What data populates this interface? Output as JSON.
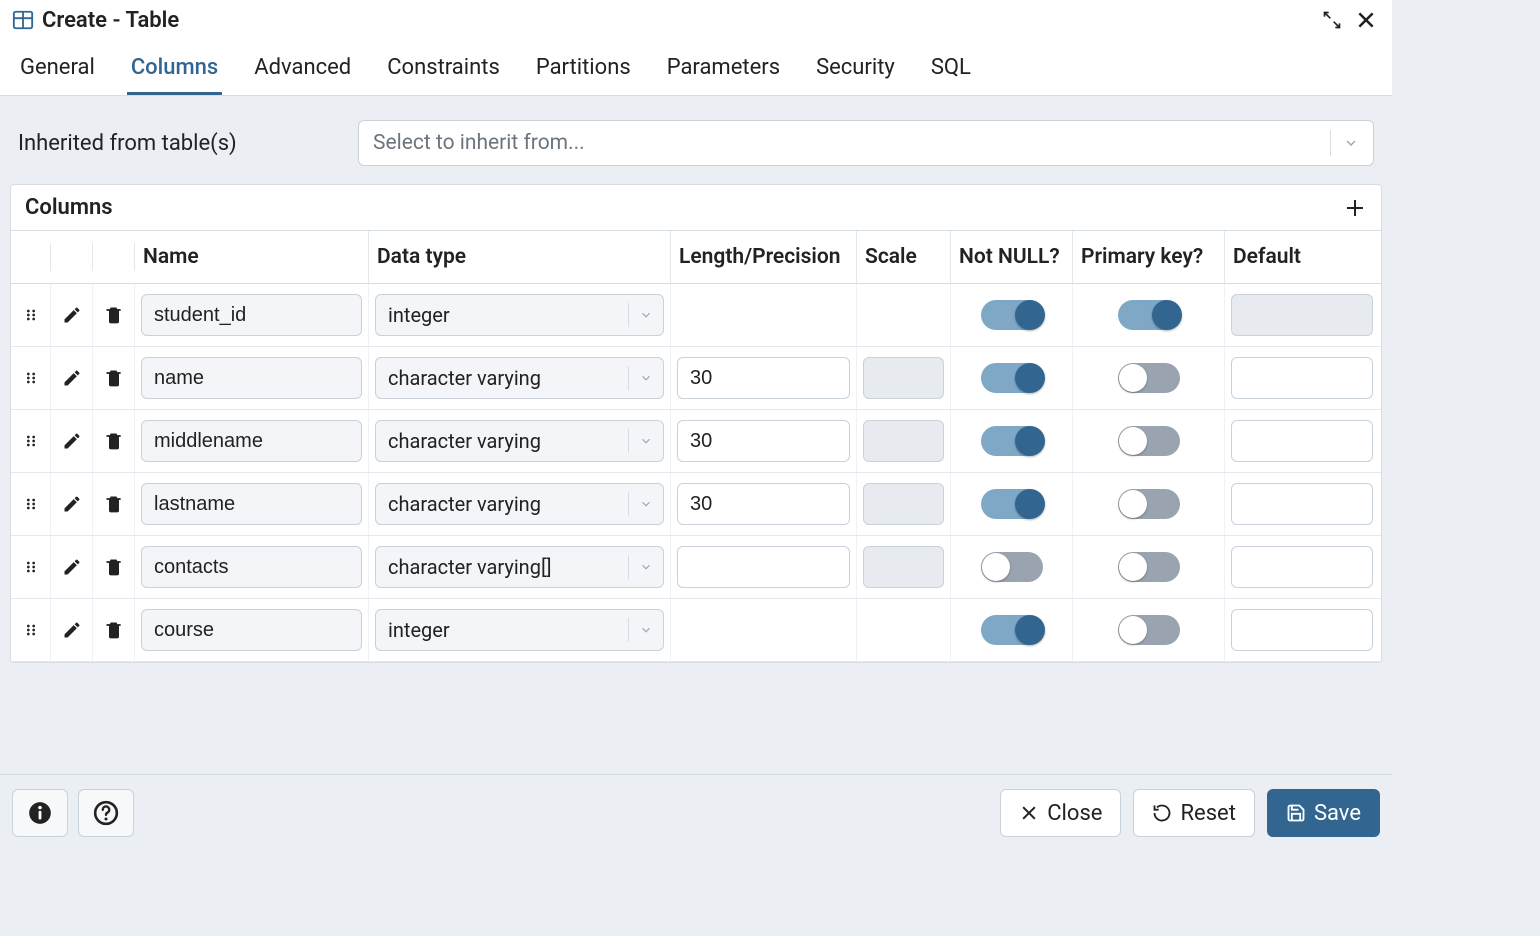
{
  "title": "Create - Table",
  "tabs": [
    "General",
    "Columns",
    "Advanced",
    "Constraints",
    "Partitions",
    "Parameters",
    "Security",
    "SQL"
  ],
  "active_tab": "Columns",
  "inherit": {
    "label": "Inherited from table(s)",
    "placeholder": "Select to inherit from..."
  },
  "columns_section": {
    "title": "Columns",
    "headers": {
      "name": "Name",
      "datatype": "Data type",
      "length": "Length/Precision",
      "scale": "Scale",
      "notnull": "Not NULL?",
      "pk": "Primary key?",
      "default": "Default"
    }
  },
  "rows": [
    {
      "name": "student_id",
      "datatype": "integer",
      "length": "",
      "scale": "",
      "length_enabled": false,
      "scale_enabled": false,
      "notnull": true,
      "pk": true,
      "default": "",
      "default_enabled": false
    },
    {
      "name": "name",
      "datatype": "character varying",
      "length": "30",
      "scale": "",
      "length_enabled": true,
      "scale_enabled": false,
      "notnull": true,
      "pk": false,
      "default": "",
      "default_enabled": true
    },
    {
      "name": "middlename",
      "datatype": "character varying",
      "length": "30",
      "scale": "",
      "length_enabled": true,
      "scale_enabled": false,
      "notnull": true,
      "pk": false,
      "default": "",
      "default_enabled": true
    },
    {
      "name": "lastname",
      "datatype": "character varying",
      "length": "30",
      "scale": "",
      "length_enabled": true,
      "scale_enabled": false,
      "notnull": true,
      "pk": false,
      "default": "",
      "default_enabled": true
    },
    {
      "name": "contacts",
      "datatype": "character varying[]",
      "length": "",
      "scale": "",
      "length_enabled": true,
      "scale_enabled": false,
      "notnull": false,
      "pk": false,
      "default": "",
      "default_enabled": true
    },
    {
      "name": "course",
      "datatype": "integer",
      "length": "",
      "scale": "",
      "length_enabled": false,
      "scale_enabled": false,
      "notnull": true,
      "pk": false,
      "default": "",
      "default_enabled": true
    }
  ],
  "footer": {
    "close": "Close",
    "reset": "Reset",
    "save": "Save"
  }
}
